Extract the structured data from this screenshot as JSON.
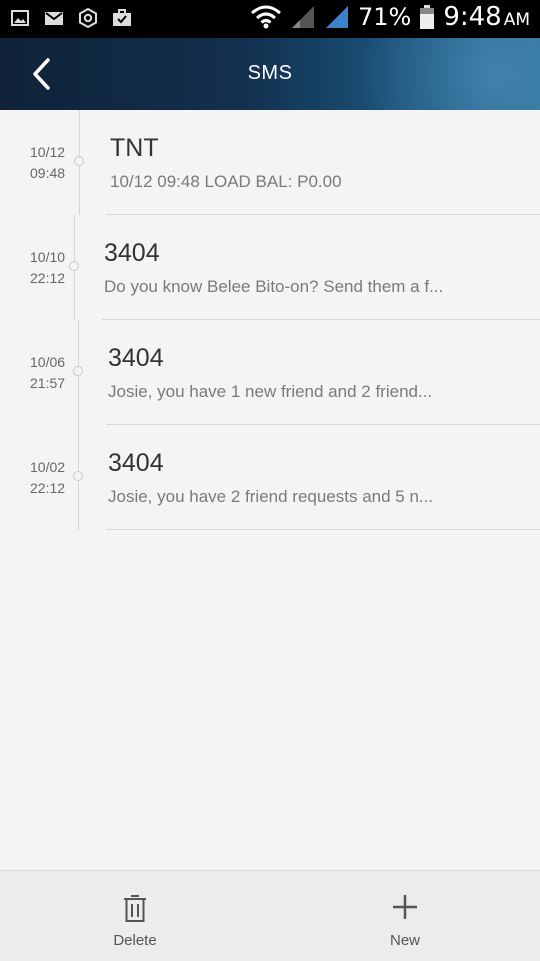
{
  "status_bar": {
    "battery": "71%",
    "time": "9:48",
    "ampm": "AM",
    "icons_left": [
      "image-icon",
      "gmail-icon",
      "settings-icon",
      "briefcase-icon"
    ],
    "icons_right": [
      "wifi-icon",
      "signal-icon",
      "signal-icon",
      "battery-icon"
    ]
  },
  "header": {
    "title": "SMS"
  },
  "messages": [
    {
      "date": "10/12",
      "time": "09:48",
      "sender": "TNT",
      "preview": "10/12 09:48 LOAD BAL: P0.00"
    },
    {
      "date": "10/10",
      "time": "22:12",
      "sender": "3404",
      "preview": "Do you know Belee Bito-on? Send them a f..."
    },
    {
      "date": "10/06",
      "time": "21:57",
      "sender": "3404",
      "preview": "Josie, you have 1 new friend and 2 friend..."
    },
    {
      "date": "10/02",
      "time": "22:12",
      "sender": "3404",
      "preview": "Josie, you have 2 friend requests and 5 n..."
    }
  ],
  "bottom_bar": {
    "delete_label": "Delete",
    "new_label": "New"
  }
}
